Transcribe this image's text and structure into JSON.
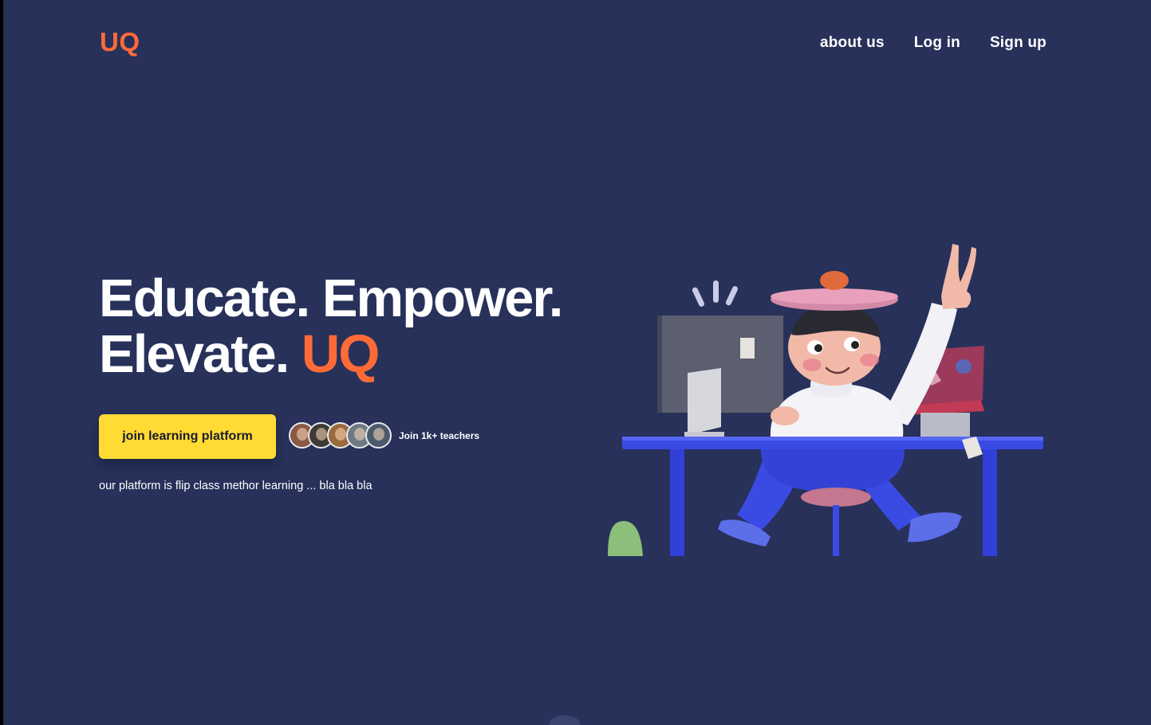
{
  "header": {
    "logo": "UQ",
    "nav": [
      "about us",
      "Log in",
      "Sign up"
    ]
  },
  "hero": {
    "headline_line1": "Educate. Empower.",
    "headline_line2": "Elevate.",
    "headline_accent": "UQ",
    "cta_label": "join learning platform",
    "teachers_label": "Join 1k+ teachers",
    "tagline": "our platform is flip class methor learning ... bla bla bla"
  },
  "colors": {
    "background": "#27315a",
    "accent": "#ff6a37",
    "button": "#ffdb34"
  },
  "avatars": [
    {
      "name": "avatar-1",
      "color": "#8a5a44"
    },
    {
      "name": "avatar-2",
      "color": "#3e3a34"
    },
    {
      "name": "avatar-3",
      "color": "#9b6a3c"
    },
    {
      "name": "avatar-4",
      "color": "#6d7a84"
    },
    {
      "name": "avatar-5",
      "color": "#4b5a6b"
    }
  ]
}
